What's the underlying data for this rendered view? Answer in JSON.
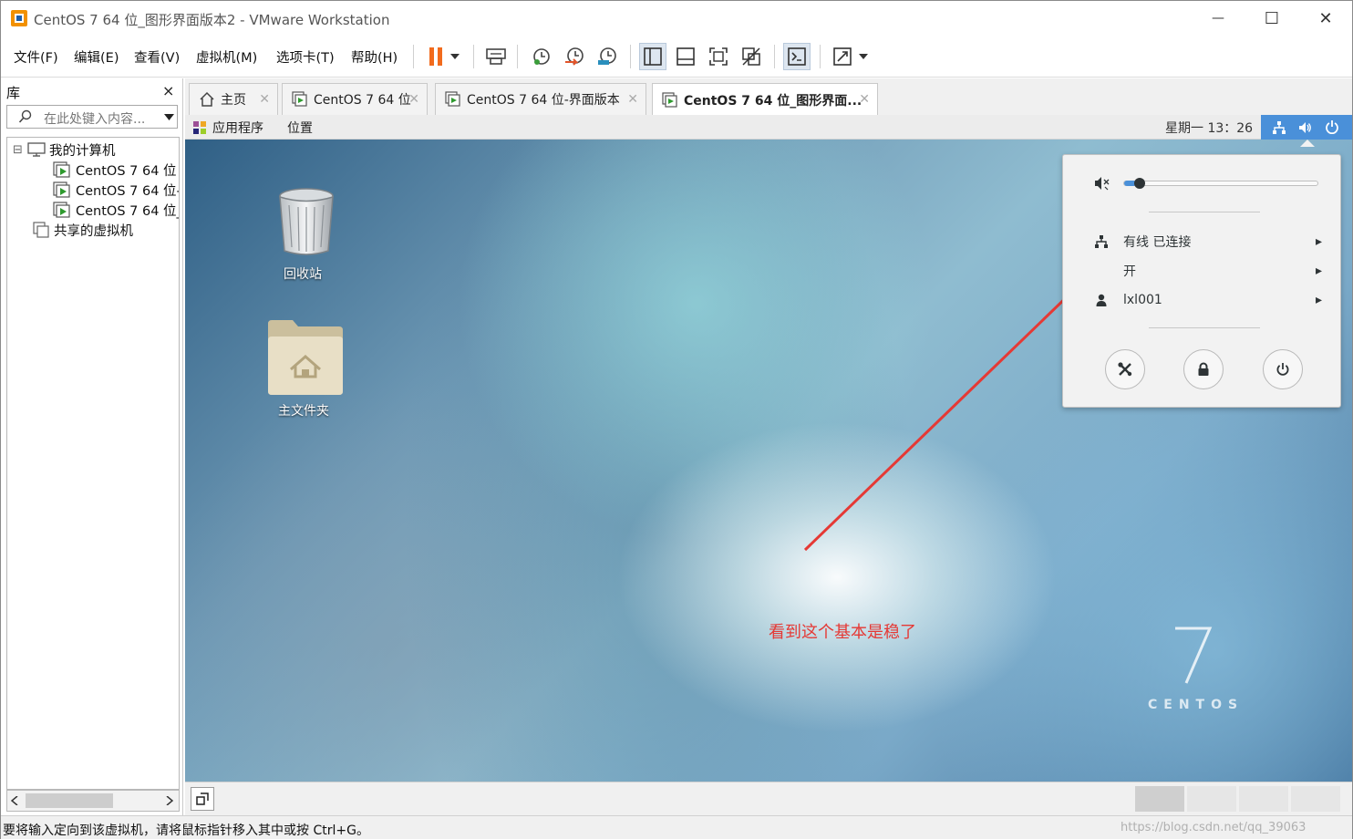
{
  "window": {
    "title": "CentOS 7 64 位_图形界面版本2 - VMware Workstation",
    "minimize_glyph": "—",
    "maximize_glyph": "☐",
    "close_glyph": "✕"
  },
  "menu": {
    "file": "文件(F)",
    "edit": "编辑(E)",
    "view": "查看(V)",
    "vm": "虚拟机(M)",
    "tabs": "选项卡(T)",
    "help": "帮助(H)"
  },
  "toolbar_icons": [
    "pause-icon",
    "send-ctrl-alt-del-icon",
    "snapshot-take-icon",
    "snapshot-revert-icon",
    "snapshot-manager-icon",
    "library-view-icon",
    "thumbnail-bar-icon",
    "fullscreen-icon",
    "unity-icon",
    "console-icon",
    "stretch-icon"
  ],
  "library": {
    "title": "库",
    "close_glyph": "×",
    "search_placeholder": "在此处键入内容...",
    "tree": {
      "expander": "⊟",
      "root": "我的计算机",
      "vms": [
        "CentOS 7 64 位",
        "CentOS 7 64 位-",
        "CentOS 7 64 位_"
      ],
      "shared": "共享的虚拟机"
    }
  },
  "tabs": [
    {
      "label": "主页",
      "close": "✕"
    },
    {
      "label": "CentOS 7 64 位",
      "close": "✕"
    },
    {
      "label": "CentOS 7 64 位-界面版本",
      "close": "✕"
    },
    {
      "label": "CentOS 7 64 位_图形界面...",
      "close": "✕"
    }
  ],
  "guest": {
    "applications": "应用程序",
    "places": "位置",
    "clock": "星期一 13：26",
    "desktop_icons": {
      "trash": "回收站",
      "home": "主文件夹"
    },
    "system_menu": {
      "volume_level": 0.06,
      "wired": "有线  已连接",
      "wifi_state": "开",
      "user": "lxl001",
      "submenu_arrow": "▸"
    },
    "annotation": "看到这个基本是稳了",
    "brand_number": "7",
    "brand_word": "CENTOS"
  },
  "status": {
    "message": "要将输入定向到该虚拟机，请将鼠标指针移入其中或按 Ctrl+G。",
    "watermark": "https://blog.csdn.net/qq_39063"
  },
  "colors": {
    "tray_blue": "#4a90d9",
    "annotation_red": "#e53935",
    "pause_orange": "#f26b1d"
  }
}
